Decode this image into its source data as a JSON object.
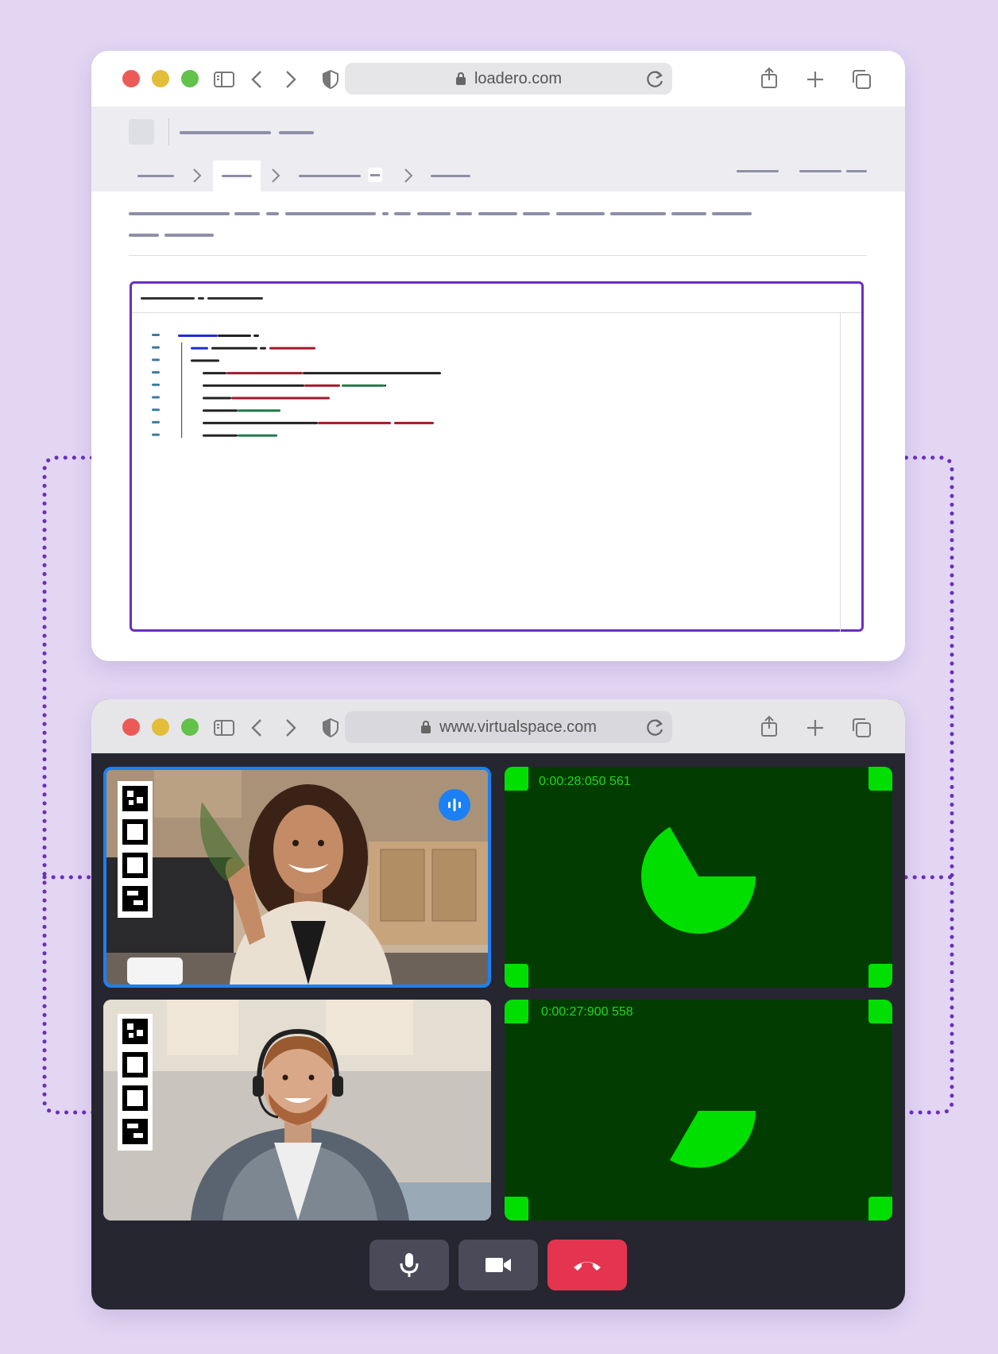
{
  "top_window": {
    "url": "loadero.com",
    "icons": [
      "sidebar-icon",
      "back-icon",
      "forward-icon",
      "privacy-shield-icon",
      "lock-icon",
      "reload-icon",
      "share-icon",
      "new-tab-icon",
      "tabs-overview-icon"
    ]
  },
  "bottom_window": {
    "url": "www.virtualspace.com",
    "tiles": [
      {
        "id": "participant-1",
        "speaking": true
      },
      {
        "id": "timer-tile-1",
        "timestamp": "0:00:28:050 561"
      },
      {
        "id": "participant-2",
        "speaking": false
      },
      {
        "id": "timer-tile-2",
        "timestamp": "0:00:27:900 558"
      }
    ],
    "controls": [
      "microphone-icon",
      "camera-icon",
      "hang-up-icon"
    ]
  },
  "colors": {
    "background": "#e2d6f3",
    "accent_purple": "#6b2fbf",
    "timer_green": "#00df00",
    "hangup_red": "#e5344f",
    "speaker_blue": "#1b80f3"
  }
}
